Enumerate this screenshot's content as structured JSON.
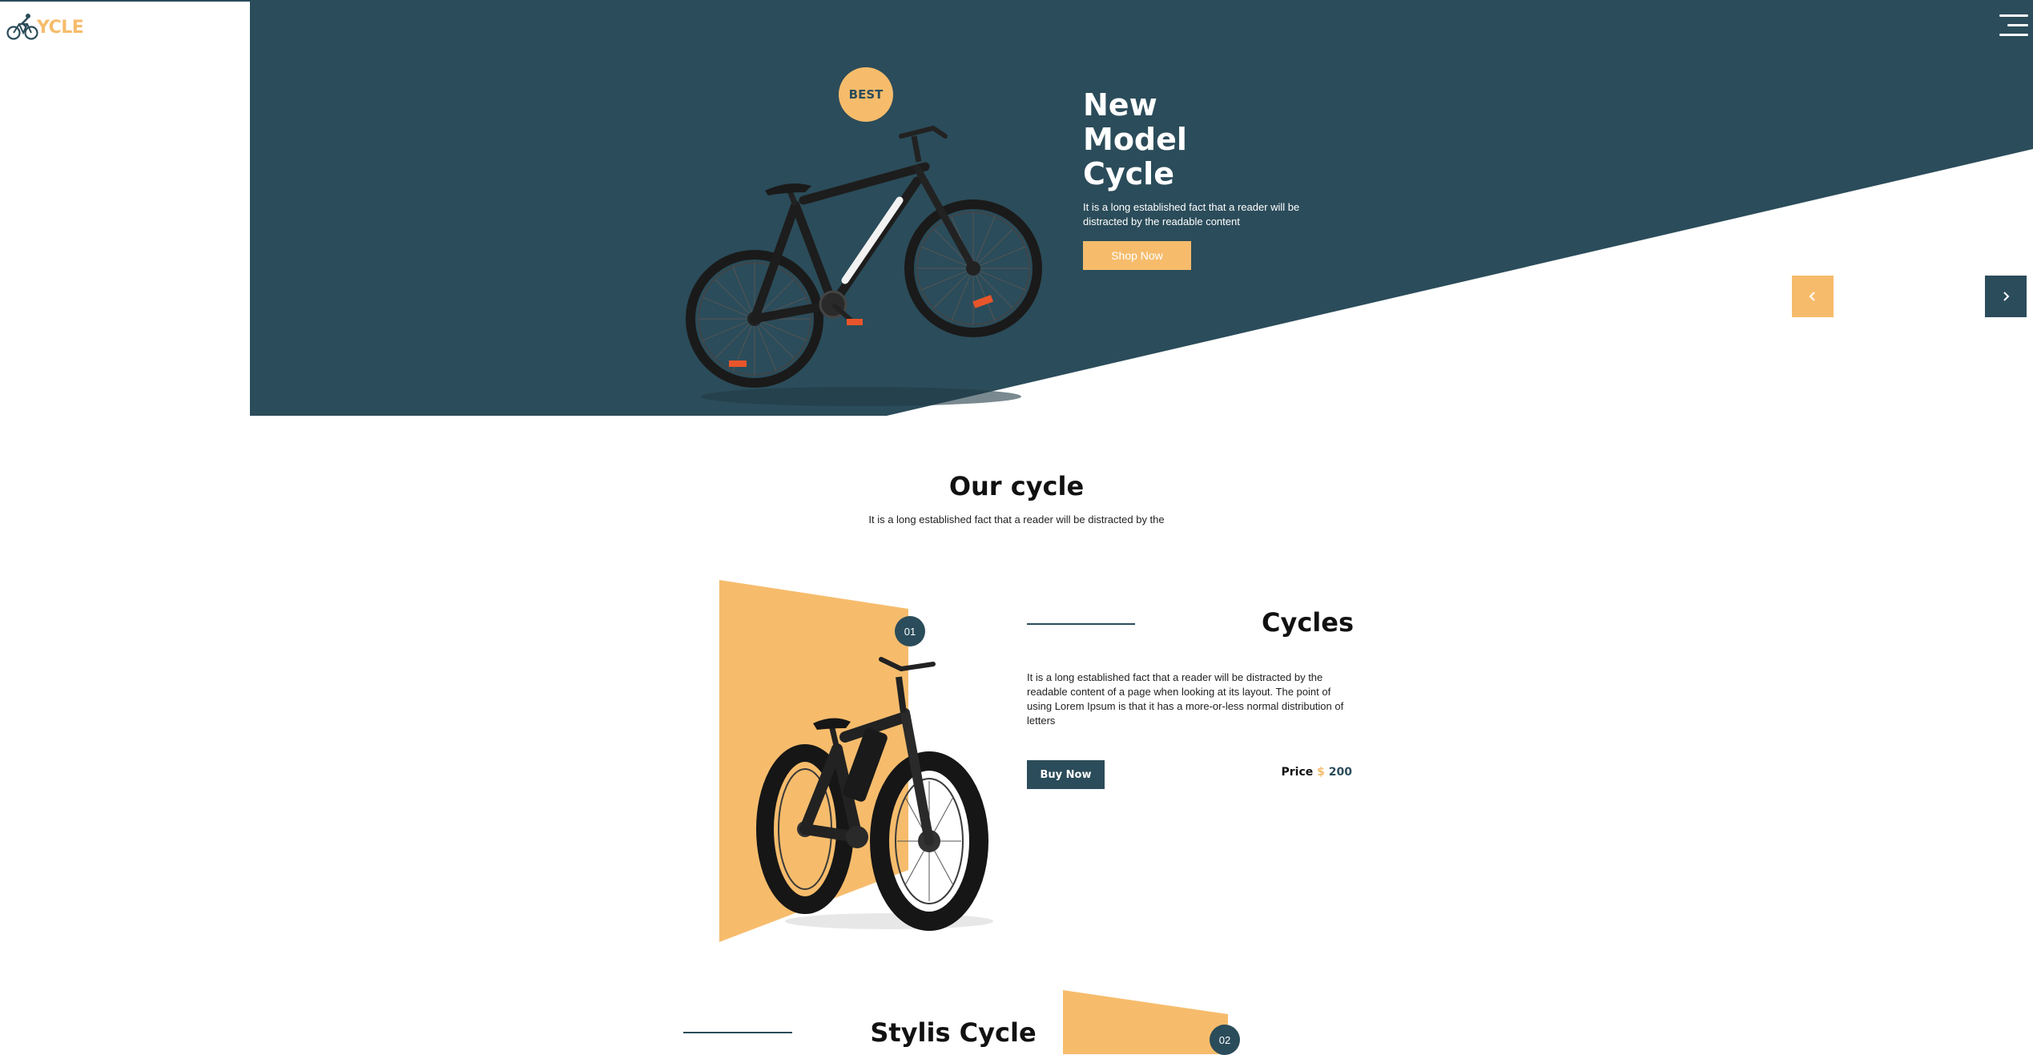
{
  "colors": {
    "primary": "#2b4c5a",
    "accent": "#f6bc6c",
    "background": "#ffffff"
  },
  "logo": {
    "text": "YCLE",
    "icon": "bicycle-rider-icon"
  },
  "header": {
    "menu_icon": "hamburger-menu-icon"
  },
  "hero": {
    "badge": "BEST",
    "title_lines": [
      "New",
      "Model",
      "Cycle"
    ],
    "description": "It is a long established fact that a reader will be distracted by the readable content",
    "cta": "Shop Now",
    "prev_icon": "chevron-left-icon",
    "next_icon": "chevron-right-icon"
  },
  "section": {
    "title": "Our cycle",
    "subtitle": "It is a long established fact that a reader will be distracted by the"
  },
  "products": [
    {
      "number": "01",
      "title": "Cycles",
      "description": "It is a long established fact that a reader will be distracted by the readable content of a page when looking at its layout. The point of using Lorem Ipsum is that it has a more-or-less normal distribution of letters",
      "button": "Buy Now",
      "price_label": "Price",
      "currency": "$",
      "price": "200"
    },
    {
      "number": "02",
      "title": "Stylis Cycle"
    }
  ]
}
